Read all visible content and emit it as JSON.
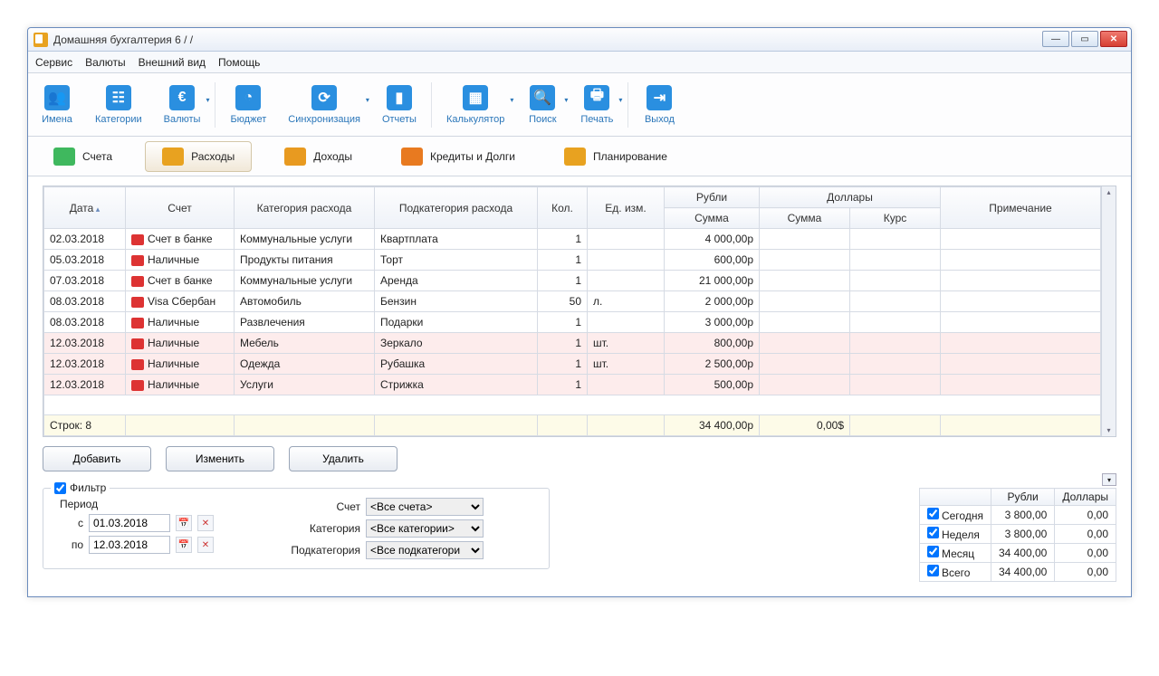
{
  "title": "Домашняя бухгалтерия 6 /                 /",
  "menu": {
    "service": "Сервис",
    "currencies": "Валюты",
    "view": "Внешний вид",
    "help": "Помощь"
  },
  "toolbar": {
    "names": "Имена",
    "categories": "Категории",
    "currencies": "Валюты",
    "budget": "Бюджет",
    "sync": "Синхронизация",
    "reports": "Отчеты",
    "calc": "Калькулятор",
    "search": "Поиск",
    "print": "Печать",
    "exit": "Выход"
  },
  "tabs": {
    "accounts": "Счета",
    "expenses": "Расходы",
    "income": "Доходы",
    "credits": "Кредиты и Долги",
    "planning": "Планирование"
  },
  "grid": {
    "headers": {
      "date": "Дата",
      "account": "Счет",
      "category": "Категория расхода",
      "subcategory": "Подкатегория расхода",
      "qty": "Кол.",
      "unit": "Ед. изм.",
      "rub": "Рубли",
      "usd": "Доллары",
      "sum": "Сумма",
      "rate": "Курс",
      "note": "Примечание"
    },
    "rows": [
      {
        "date": "02.03.2018",
        "acc": "Счет в банке",
        "accType": "bank",
        "cat": "Коммунальные услуги",
        "sub": "Квартплата",
        "qty": "1",
        "unit": "",
        "rub": "4 000,00р",
        "usd_sum": "",
        "usd_rate": "",
        "note": "",
        "hl": false
      },
      {
        "date": "05.03.2018",
        "acc": "Наличные",
        "accType": "cash",
        "cat": "Продукты питания",
        "sub": "Торт",
        "qty": "1",
        "unit": "",
        "rub": "600,00р",
        "usd_sum": "",
        "usd_rate": "",
        "note": "",
        "hl": false
      },
      {
        "date": "07.03.2018",
        "acc": "Счет в банке",
        "accType": "bank",
        "cat": "Коммунальные услуги",
        "sub": "Аренда",
        "qty": "1",
        "unit": "",
        "rub": "21 000,00р",
        "usd_sum": "",
        "usd_rate": "",
        "note": "",
        "hl": false
      },
      {
        "date": "08.03.2018",
        "acc": "Visa Сбербан",
        "accType": "card",
        "cat": "Автомобиль",
        "sub": "Бензин",
        "qty": "50",
        "unit": "л.",
        "rub": "2 000,00р",
        "usd_sum": "",
        "usd_rate": "",
        "note": "",
        "hl": false
      },
      {
        "date": "08.03.2018",
        "acc": "Наличные",
        "accType": "cash",
        "cat": "Развлечения",
        "sub": "Подарки",
        "qty": "1",
        "unit": "",
        "rub": "3 000,00р",
        "usd_sum": "",
        "usd_rate": "",
        "note": "",
        "hl": false
      },
      {
        "date": "12.03.2018",
        "acc": "Наличные",
        "accType": "cash",
        "cat": "Мебель",
        "sub": "Зеркало",
        "qty": "1",
        "unit": "шт.",
        "rub": "800,00р",
        "usd_sum": "",
        "usd_rate": "",
        "note": "",
        "hl": true
      },
      {
        "date": "12.03.2018",
        "acc": "Наличные",
        "accType": "cash",
        "cat": "Одежда",
        "sub": "Рубашка",
        "qty": "1",
        "unit": "шт.",
        "rub": "2 500,00р",
        "usd_sum": "",
        "usd_rate": "",
        "note": "",
        "hl": true
      },
      {
        "date": "12.03.2018",
        "acc": "Наличные",
        "accType": "cash",
        "cat": "Услуги",
        "sub": "Стрижка",
        "qty": "1",
        "unit": "",
        "rub": "500,00р",
        "usd_sum": "",
        "usd_rate": "",
        "note": "",
        "hl": true
      }
    ],
    "summary": {
      "rows_label": "Строк: 8",
      "rub_total": "34 400,00р",
      "usd_total": "0,00$"
    }
  },
  "buttons": {
    "add": "Добавить",
    "edit": "Изменить",
    "delete": "Удалить"
  },
  "filter": {
    "legend": "Фильтр",
    "period": "Период",
    "from_label": "с",
    "from": "01.03.2018",
    "to_label": "по",
    "to": "12.03.2018",
    "account_label": "Счет",
    "account_value": "<Все счета>",
    "category_label": "Категория",
    "category_value": "<Все категории>",
    "subcategory_label": "Подкатегория",
    "subcategory_value": "<Все подкатегори"
  },
  "summary_box": {
    "rub": "Рубли",
    "usd": "Доллары",
    "rows": [
      {
        "label": "Сегодня",
        "rub": "3 800,00",
        "usd": "0,00"
      },
      {
        "label": "Неделя",
        "rub": "3 800,00",
        "usd": "0,00"
      },
      {
        "label": "Месяц",
        "rub": "34 400,00",
        "usd": "0,00"
      },
      {
        "label": "Всего",
        "rub": "34 400,00",
        "usd": "0,00"
      }
    ]
  }
}
